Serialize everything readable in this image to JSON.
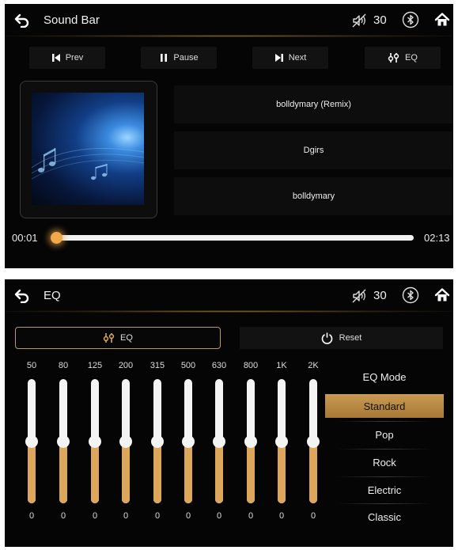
{
  "player": {
    "title": "Sound Bar",
    "volume": "30",
    "controls": {
      "prev": "Prev",
      "pause": "Pause",
      "next": "Next",
      "eq": "EQ"
    },
    "song": "bolldymary (Remix)",
    "artist": "Dgirs",
    "album": "bolldymary",
    "time_current": "00:01",
    "time_total": "02:13",
    "progress_fraction": 0.01
  },
  "eq": {
    "title": "EQ",
    "volume": "30",
    "eq_label": "EQ",
    "reset_label": "Reset",
    "bands": [
      {
        "label": "50",
        "value": "0"
      },
      {
        "label": "80",
        "value": "0"
      },
      {
        "label": "125",
        "value": "0"
      },
      {
        "label": "200",
        "value": "0"
      },
      {
        "label": "315",
        "value": "0"
      },
      {
        "label": "500",
        "value": "0"
      },
      {
        "label": "630",
        "value": "0"
      },
      {
        "label": "800",
        "value": "0"
      },
      {
        "label": "1K",
        "value": "0"
      },
      {
        "label": "2K",
        "value": "0"
      }
    ],
    "band_level_fraction": 0.5,
    "mode_title": "EQ Mode",
    "modes": [
      "Standard",
      "Pop",
      "Rock",
      "Electric",
      "Classic"
    ],
    "selected_mode": "Standard"
  },
  "colors": {
    "accent": "#dca75a",
    "background": "#050505",
    "text": "#e8e8e8"
  },
  "icons": [
    "back-icon",
    "volume-mute-icon",
    "bluetooth-icon",
    "home-icon",
    "prev-icon",
    "pause-icon",
    "next-icon",
    "eq-icon",
    "reset-icon",
    "music-note-icon"
  ]
}
